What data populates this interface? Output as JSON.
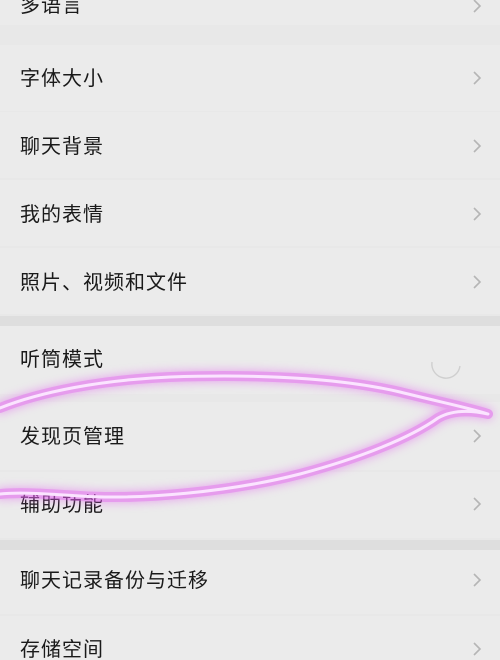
{
  "settings": {
    "items": [
      {
        "label": "多语言"
      },
      {
        "label": "字体大小"
      },
      {
        "label": "聊天背景"
      },
      {
        "label": "我的表情"
      },
      {
        "label": "照片、视频和文件"
      },
      {
        "label": "听筒模式"
      },
      {
        "label": "发现页管理"
      },
      {
        "label": "辅助功能"
      },
      {
        "label": "聊天记录备份与迁移"
      },
      {
        "label": "存储空间"
      }
    ]
  },
  "colors": {
    "background": "#e8e8e8",
    "row": "#ebebeb",
    "text": "#1a1a1a",
    "chevron": "#b5b5b5",
    "scribble": "#e25cf0"
  },
  "icons": {
    "chevron": "chevron-right-icon"
  }
}
